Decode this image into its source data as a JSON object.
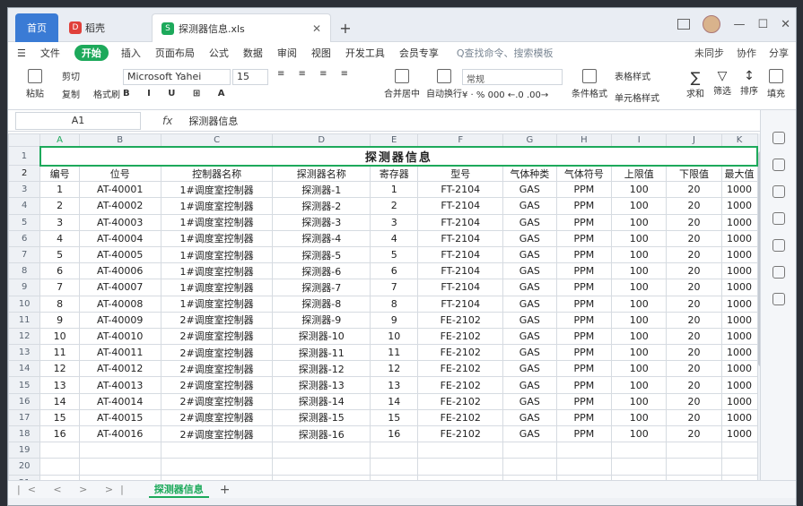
{
  "tabs": {
    "home": "首页",
    "draft": "稻壳",
    "document": "探测器信息.xls"
  },
  "menu": {
    "file": "文件",
    "start": "开始",
    "items": [
      "插入",
      "页面布局",
      "公式",
      "数据",
      "审阅",
      "视图",
      "开发工具",
      "会员专享"
    ],
    "search": "Q查找命令、搜索模板",
    "sync": "未同步",
    "collab": "协作",
    "share": "分享"
  },
  "ribbon": {
    "paste": "粘贴",
    "cut": "剪切",
    "copy": "复制",
    "format_painter": "格式刷",
    "font": "Microsoft Yahei",
    "size": "15",
    "merge": "合并居中",
    "wrap": "自动换行",
    "number_format": "常规",
    "cond_format": "条件格式",
    "table_style": "表格样式",
    "cell_style": "单元格样式",
    "sum": "求和",
    "filter": "筛选",
    "sort": "排序",
    "fill": "填充"
  },
  "formula_bar": {
    "cell": "A1",
    "fx": "fx",
    "value": "探测器信息"
  },
  "columns": [
    "A",
    "B",
    "C",
    "D",
    "E",
    "F",
    "G",
    "H",
    "I",
    "J",
    "K"
  ],
  "sheet_title": "探测器信息",
  "headers": [
    "编号",
    "位号",
    "控制器名称",
    "探测器名称",
    "寄存器",
    "型号",
    "气体种类",
    "气体符号",
    "上限值",
    "下限值",
    "最大值"
  ],
  "rows": [
    [
      "1",
      "AT-40001",
      "1#调度室控制器",
      "探测器-1",
      "1",
      "FT-2104",
      "GAS",
      "PPM",
      "100",
      "20",
      "1000"
    ],
    [
      "2",
      "AT-40002",
      "1#调度室控制器",
      "探测器-2",
      "2",
      "FT-2104",
      "GAS",
      "PPM",
      "100",
      "20",
      "1000"
    ],
    [
      "3",
      "AT-40003",
      "1#调度室控制器",
      "探测器-3",
      "3",
      "FT-2104",
      "GAS",
      "PPM",
      "100",
      "20",
      "1000"
    ],
    [
      "4",
      "AT-40004",
      "1#调度室控制器",
      "探测器-4",
      "4",
      "FT-2104",
      "GAS",
      "PPM",
      "100",
      "20",
      "1000"
    ],
    [
      "5",
      "AT-40005",
      "1#调度室控制器",
      "探测器-5",
      "5",
      "FT-2104",
      "GAS",
      "PPM",
      "100",
      "20",
      "1000"
    ],
    [
      "6",
      "AT-40006",
      "1#调度室控制器",
      "探测器-6",
      "6",
      "FT-2104",
      "GAS",
      "PPM",
      "100",
      "20",
      "1000"
    ],
    [
      "7",
      "AT-40007",
      "1#调度室控制器",
      "探测器-7",
      "7",
      "FT-2104",
      "GAS",
      "PPM",
      "100",
      "20",
      "1000"
    ],
    [
      "8",
      "AT-40008",
      "1#调度室控制器",
      "探测器-8",
      "8",
      "FT-2104",
      "GAS",
      "PPM",
      "100",
      "20",
      "1000"
    ],
    [
      "9",
      "AT-40009",
      "2#调度室控制器",
      "探测器-9",
      "9",
      "FE-2102",
      "GAS",
      "PPM",
      "100",
      "20",
      "1000"
    ],
    [
      "10",
      "AT-40010",
      "2#调度室控制器",
      "探测器-10",
      "10",
      "FE-2102",
      "GAS",
      "PPM",
      "100",
      "20",
      "1000"
    ],
    [
      "11",
      "AT-40011",
      "2#调度室控制器",
      "探测器-11",
      "11",
      "FE-2102",
      "GAS",
      "PPM",
      "100",
      "20",
      "1000"
    ],
    [
      "12",
      "AT-40012",
      "2#调度室控制器",
      "探测器-12",
      "12",
      "FE-2102",
      "GAS",
      "PPM",
      "100",
      "20",
      "1000"
    ],
    [
      "13",
      "AT-40013",
      "2#调度室控制器",
      "探测器-13",
      "13",
      "FE-2102",
      "GAS",
      "PPM",
      "100",
      "20",
      "1000"
    ],
    [
      "14",
      "AT-40014",
      "2#调度室控制器",
      "探测器-14",
      "14",
      "FE-2102",
      "GAS",
      "PPM",
      "100",
      "20",
      "1000"
    ],
    [
      "15",
      "AT-40015",
      "2#调度室控制器",
      "探测器-15",
      "15",
      "FE-2102",
      "GAS",
      "PPM",
      "100",
      "20",
      "1000"
    ],
    [
      "16",
      "AT-40016",
      "2#调度室控制器",
      "探测器-16",
      "16",
      "FE-2102",
      "GAS",
      "PPM",
      "100",
      "20",
      "1000"
    ]
  ],
  "row_numbers": [
    "1",
    "2",
    "3",
    "4",
    "5",
    "6",
    "7",
    "8",
    "9",
    "10",
    "11",
    "12",
    "13",
    "14",
    "15",
    "16",
    "17",
    "18",
    "19",
    "20",
    "21"
  ],
  "sheet_tab": "探测器信息",
  "colors": {
    "accent": "#1da95b",
    "home_tab": "#3a7bd5"
  }
}
